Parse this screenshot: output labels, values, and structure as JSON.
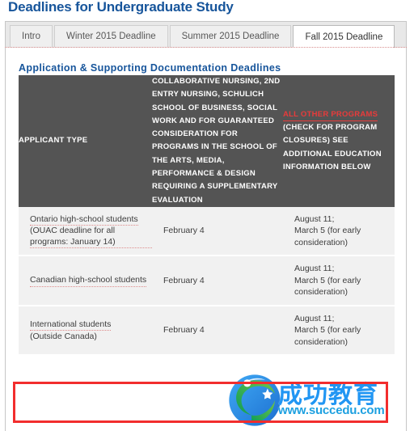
{
  "page": {
    "title": "Deadlines for Undergraduate Study"
  },
  "tabs": [
    {
      "label": "Intro",
      "active": false
    },
    {
      "label": "Winter 2015 Deadline",
      "active": false
    },
    {
      "label": "Summer 2015 Deadline",
      "active": false
    },
    {
      "label": "Fall 2015 Deadline",
      "active": true
    }
  ],
  "section": {
    "heading": "Application & Supporting Documentation Deadlines"
  },
  "table": {
    "headers": {
      "applicant_type": "APPLICANT TYPE",
      "collaborative": "COLLABORATIVE NURSING, 2ND ENTRY NURSING, SCHULICH SCHOOL OF BUSINESS, SOCIAL WORK AND FOR GUARANTEED CONSIDERATION FOR PROGRAMS IN THE SCHOOL OF THE ARTS, MEDIA, PERFORMANCE & DESIGN REQUIRING A SUPPLEMENTARY EVALUATION",
      "all_other_link": "ALL OTHER PROGRAMS",
      "all_other_rest": "(CHECK FOR PROGRAM CLOSURES) SEE ADDITIONAL EDUCATION INFORMATION BELOW"
    },
    "rows": [
      {
        "type_main": "Ontario high-school students",
        "type_note": "(OUAC deadline for all programs: January 14)",
        "collaborative": "February 4",
        "all_other": "August 11;\nMarch 5 (for early consideration)",
        "highlighted": false
      },
      {
        "type_main": "Canadian high-school students",
        "type_note": "",
        "collaborative": "February 4",
        "all_other": "August 11;\nMarch 5 (for early consideration)",
        "highlighted": false
      },
      {
        "type_main": "International students",
        "type_note": "(Outside Canada)",
        "collaborative": "February 4",
        "all_other": "August 11;\nMarch 5 (for early consideration)",
        "highlighted": true
      }
    ]
  },
  "watermark": {
    "chinese": "成功教育",
    "url": "www.succedu.com"
  },
  "colors": {
    "title_blue": "#17559b",
    "header_gray": "#545454",
    "row_gray": "#f1f1f1",
    "link_red": "#e83b3b",
    "highlight_red": "#f22d2d",
    "watermark_blue": "#2196f3"
  }
}
